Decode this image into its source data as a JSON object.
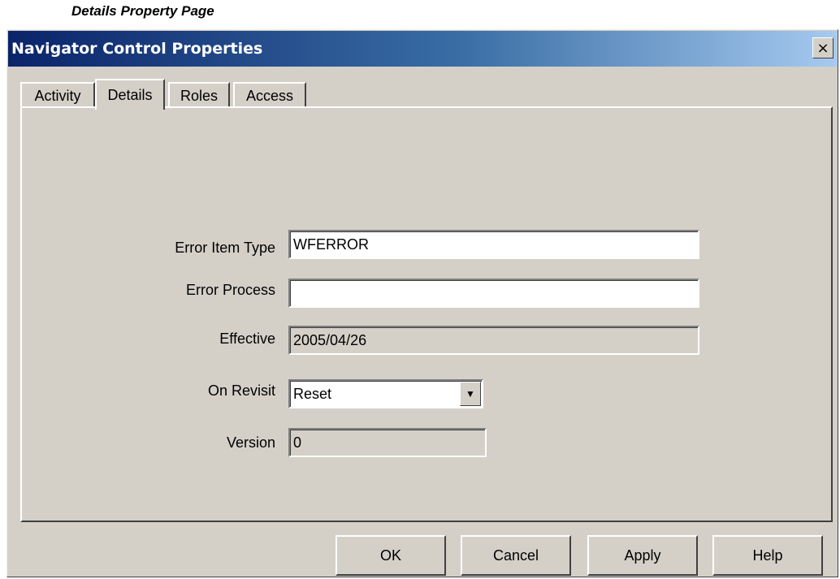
{
  "caption": "Details Property Page",
  "window": {
    "title": "Navigator Control Properties",
    "close_glyph": "×"
  },
  "tabs": [
    {
      "label": "Activity",
      "active": false
    },
    {
      "label": "Details",
      "active": true
    },
    {
      "label": "Roles",
      "active": false
    },
    {
      "label": "Access",
      "active": false
    }
  ],
  "fields": {
    "error_item_type": {
      "label": "Error Item Type",
      "value": "WFERROR"
    },
    "error_process": {
      "label": "Error Process",
      "value": ""
    },
    "effective": {
      "label": "Effective",
      "value": "2005/04/26"
    },
    "on_revisit": {
      "label": "On Revisit",
      "value": "Reset"
    },
    "version": {
      "label": "Version",
      "value": "0"
    }
  },
  "buttons": {
    "ok": "OK",
    "cancel": "Cancel",
    "apply": "Apply",
    "help": "Help"
  },
  "icons": {
    "close": "close-icon",
    "dropdown": "chevron-down-icon"
  },
  "colors": {
    "title_gradient_start": "#0a246a",
    "title_gradient_end": "#a6caf0",
    "dialog_face": "#d4d0c8"
  }
}
